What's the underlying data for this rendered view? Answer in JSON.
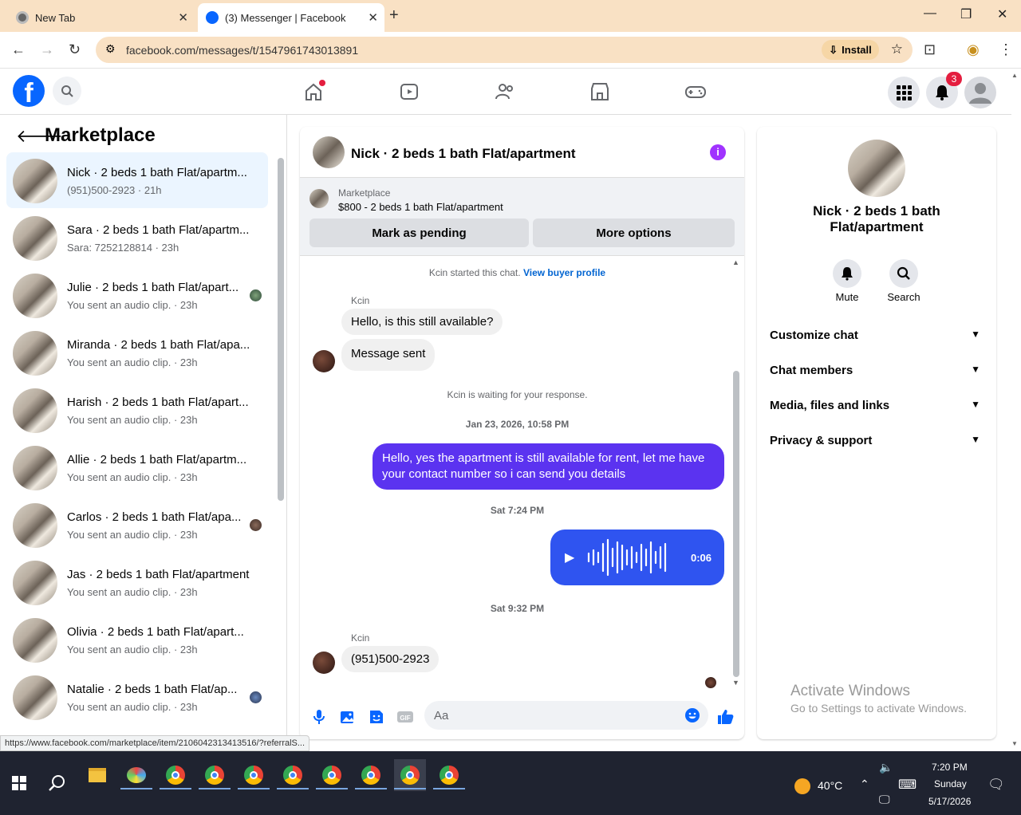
{
  "browser": {
    "tabs": [
      {
        "title": "New Tab"
      },
      {
        "title": "(3) Messenger | Facebook"
      }
    ],
    "url": "facebook.com/messages/t/1547961743013891",
    "install_label": "Install"
  },
  "header": {
    "notification_count": "3"
  },
  "sidebar": {
    "title": "Marketplace",
    "conversations": [
      {
        "name": "Nick · 2 beds 1 bath Flat/apartm...",
        "sub": "(951)500-2923 · 21h"
      },
      {
        "name": "Sara · 2 beds 1 bath Flat/apartm...",
        "sub": "Sara: 7252128814 · 23h"
      },
      {
        "name": "Julie · 2 beds 1 bath Flat/apart...",
        "sub": "You sent an audio clip. · 23h"
      },
      {
        "name": "Miranda · 2 beds 1 bath Flat/apa...",
        "sub": "You sent an audio clip. · 23h"
      },
      {
        "name": "Harish · 2 beds 1 bath Flat/apart...",
        "sub": "You sent an audio clip. · 23h"
      },
      {
        "name": "Allie · 2 beds 1 bath Flat/apartm...",
        "sub": "You sent an audio clip. · 23h"
      },
      {
        "name": "Carlos · 2 beds 1 bath Flat/apa...",
        "sub": "You sent an audio clip. · 23h"
      },
      {
        "name": "Jas · 2 beds 1 bath Flat/apartment",
        "sub": "You sent an audio clip. · 23h"
      },
      {
        "name": "Olivia · 2 beds 1 bath Flat/apart...",
        "sub": "You sent an audio clip. · 23h"
      },
      {
        "name": "Natalie · 2 beds 1 bath Flat/ap...",
        "sub": "You sent an audio clip. · 23h"
      }
    ]
  },
  "chat": {
    "title": "Nick · 2 beds 1 bath Flat/apartment",
    "listing_label": "Marketplace",
    "listing_price": "$800 - 2 beds 1 bath Flat/apartment",
    "mark_pending": "Mark as pending",
    "more_options": "More options",
    "started_text": "Kcin started this chat.",
    "view_profile": "View buyer profile",
    "sender1": "Kcin",
    "msg1": "Hello, is this still available?",
    "msg2": "Message sent",
    "waiting": "Kcin is waiting for your response.",
    "stamp1": "Jan 23, 2026, 10:58 PM",
    "my_msg": "Hello, yes the apartment is still available for rent, let me have your contact number so i can send you details",
    "stamp2": "Sat 7:24 PM",
    "audio_duration": "0:06",
    "stamp3": "Sat 9:32 PM",
    "sender2": "Kcin",
    "msg3": "(951)500-2923",
    "composer_placeholder": "Aa"
  },
  "info_panel": {
    "name_line1": "Nick · 2 beds 1 bath",
    "name_line2": "Flat/apartment",
    "mute": "Mute",
    "search": "Search",
    "sections": [
      "Customize chat",
      "Chat members",
      "Media, files and links",
      "Privacy & support"
    ]
  },
  "watermark": {
    "line1": "Activate Windows",
    "line2": "Go to Settings to activate Windows."
  },
  "status_url": "https://www.facebook.com/marketplace/item/2106042313413516/?referralS...",
  "taskbar": {
    "temperature": "40°C",
    "time": "7:20 PM",
    "day": "Sunday",
    "date": "5/17/2026"
  },
  "colors": {
    "fb_blue": "#0866ff",
    "my_bubble": "#5b33f0",
    "audio_bubble": "#2f54f0",
    "tab_bar": "#f9e1c4"
  }
}
